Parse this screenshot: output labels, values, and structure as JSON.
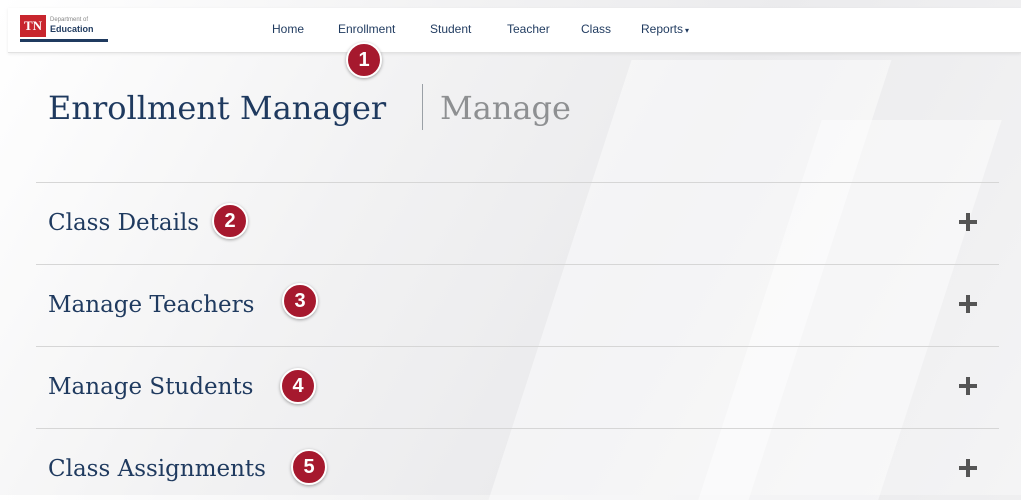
{
  "logo": {
    "tn": "TN",
    "dept": "Department of",
    "name": "Education"
  },
  "nav": [
    {
      "label": "Home"
    },
    {
      "label": "Enrollment"
    },
    {
      "label": "Student"
    },
    {
      "label": "Teacher"
    },
    {
      "label": "Class"
    },
    {
      "label": "Reports"
    }
  ],
  "header": {
    "title": "Enrollment Manager",
    "subtitle": "Manage"
  },
  "sections": [
    {
      "title": "Class Details",
      "expand_icon": "plus-icon"
    },
    {
      "title": "Manage Teachers",
      "expand_icon": "plus-icon"
    },
    {
      "title": "Manage Students",
      "expand_icon": "plus-icon"
    },
    {
      "title": "Class Assignments",
      "expand_icon": "plus-icon"
    }
  ],
  "callouts": [
    "1",
    "2",
    "3",
    "4",
    "5"
  ],
  "colors": {
    "brand_red": "#c8262e",
    "navy": "#1f3a5f",
    "callout": "#a6192e",
    "muted": "#8e9092"
  }
}
